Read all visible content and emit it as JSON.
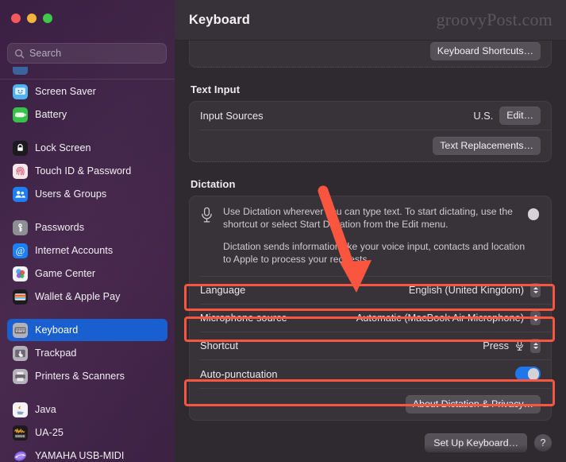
{
  "window": {
    "traffic_lights": [
      "close",
      "minimize",
      "zoom"
    ],
    "title": "Keyboard",
    "watermark": "groovyPost.com"
  },
  "sidebar": {
    "search": {
      "placeholder": "Search",
      "value": ""
    },
    "groups": [
      {
        "items": [
          {
            "label": "Screen Saver",
            "icon": "screen-saver-icon",
            "selected": false
          },
          {
            "label": "Battery",
            "icon": "battery-icon",
            "selected": false
          }
        ]
      },
      {
        "items": [
          {
            "label": "Lock Screen",
            "icon": "lock-screen-icon",
            "selected": false
          },
          {
            "label": "Touch ID & Password",
            "icon": "touch-id-icon",
            "selected": false
          },
          {
            "label": "Users & Groups",
            "icon": "users-groups-icon",
            "selected": false
          }
        ]
      },
      {
        "items": [
          {
            "label": "Passwords",
            "icon": "passwords-icon",
            "selected": false
          },
          {
            "label": "Internet Accounts",
            "icon": "internet-accounts-icon",
            "selected": false
          },
          {
            "label": "Game Center",
            "icon": "game-center-icon",
            "selected": false
          },
          {
            "label": "Wallet & Apple Pay",
            "icon": "wallet-apple-pay-icon",
            "selected": false
          }
        ]
      },
      {
        "items": [
          {
            "label": "Keyboard",
            "icon": "keyboard-icon",
            "selected": true
          },
          {
            "label": "Trackpad",
            "icon": "trackpad-icon",
            "selected": false
          },
          {
            "label": "Printers & Scanners",
            "icon": "printers-scanners-icon",
            "selected": false
          }
        ]
      },
      {
        "items": [
          {
            "label": "Java",
            "icon": "java-icon",
            "selected": false
          },
          {
            "label": "UA-25",
            "icon": "ua25-icon",
            "selected": false
          },
          {
            "label": "YAMAHA USB-MIDI",
            "icon": "yamaha-usb-midi-icon",
            "selected": false
          }
        ]
      }
    ]
  },
  "main": {
    "keyboard_shortcuts_button": "Keyboard Shortcuts…",
    "text_input": {
      "heading": "Text Input",
      "input_sources_label": "Input Sources",
      "input_sources_value": "U.S.",
      "edit_button": "Edit…",
      "text_replacements_button": "Text Replacements…"
    },
    "dictation": {
      "heading": "Dictation",
      "description_1": "Use Dictation wherever you can type text. To start dictating, use the shortcut or select Start Dictation from the Edit menu.",
      "description_2": "Dictation sends information like your voice input, contacts and location to Apple to process your requests.",
      "enabled": true,
      "rows": [
        {
          "label": "Language",
          "value": "English (United Kingdom)",
          "control": "popup-button"
        },
        {
          "label": "Microphone source",
          "value": "Automatic (MacBook Air Microphone)",
          "control": "popup-button"
        },
        {
          "label": "Shortcut",
          "value": "Press",
          "control": "popup-button-with-mic-glyph"
        },
        {
          "label": "Auto-punctuation",
          "value": "on",
          "control": "toggle"
        }
      ],
      "about_button": "About Dictation & Privacy…"
    },
    "footer": {
      "setup_keyboard_button": "Set Up Keyboard…",
      "help_button": "?"
    }
  },
  "annotations": {
    "highlight_color": "#f9553f",
    "arrow_color": "#f9553f",
    "highlighted_rows": [
      "Language",
      "Microphone source",
      "Auto-punctuation"
    ],
    "arrow_points_to": "Language"
  },
  "colors": {
    "selection_blue": "#1a5fd0",
    "toggle_blue": "#1e78eb",
    "card_background": "#383339",
    "window_background": "#2e2a30",
    "titlebar": "#373239"
  }
}
